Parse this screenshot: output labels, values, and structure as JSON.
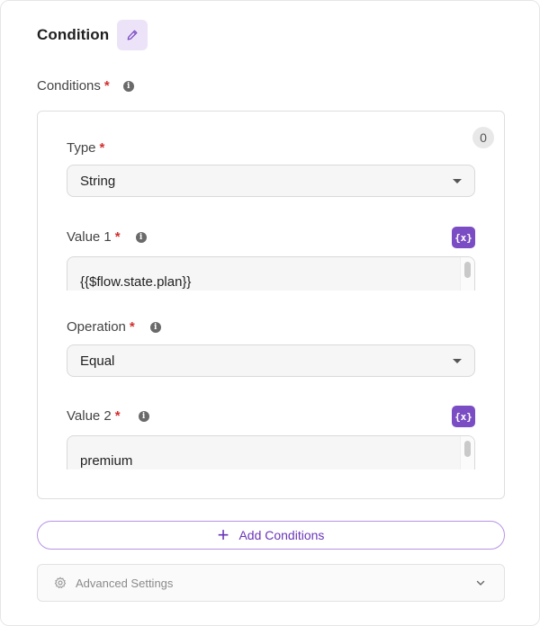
{
  "header": {
    "title": "Condition",
    "edit_icon": "pencil-icon"
  },
  "conditions": {
    "label": "Conditions",
    "required_mark": "*",
    "count": "0",
    "fields": {
      "type": {
        "label": "Type",
        "required_mark": "*",
        "value": "String"
      },
      "value1": {
        "label": "Value 1",
        "required_mark": "*",
        "value": "{{$flow.state.plan}}",
        "var_button": "{x}"
      },
      "operation": {
        "label": "Operation",
        "required_mark": "*",
        "value": "Equal"
      },
      "value2": {
        "label": "Value 2",
        "required_mark": "*",
        "value": "premium",
        "var_button": "{x}"
      }
    }
  },
  "actions": {
    "add_label": "Add Conditions",
    "add_icon": "+"
  },
  "advanced": {
    "label": "Advanced Settings",
    "icon": "gear-icon"
  },
  "colors": {
    "accent": "#7b4dc4",
    "accent_light": "#ece3f8",
    "required": "#d32f2f"
  }
}
